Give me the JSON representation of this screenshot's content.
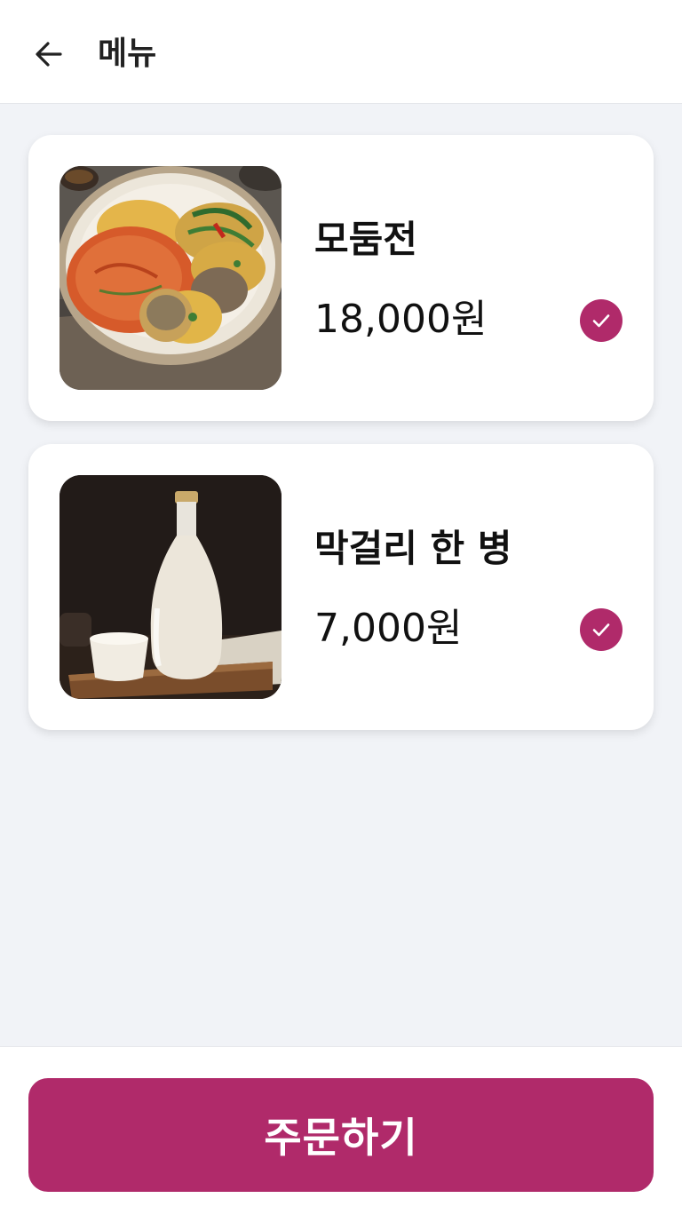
{
  "colors": {
    "accent": "#b02a6a",
    "background": "#f1f3f7",
    "card": "#ffffff",
    "text": "#111111"
  },
  "header": {
    "back_icon": "arrow-left-icon",
    "title": "메뉴"
  },
  "items": [
    {
      "name": "모둠전",
      "price": "18,000원",
      "image": "assorted-jeon-photo",
      "selected": true,
      "check_icon": "check-icon"
    },
    {
      "name": "막걸리 한 병",
      "price": "7,000원",
      "image": "makgeolli-bottle-photo",
      "selected": true,
      "check_icon": "check-icon"
    }
  ],
  "footer": {
    "order_label": "주문하기"
  }
}
